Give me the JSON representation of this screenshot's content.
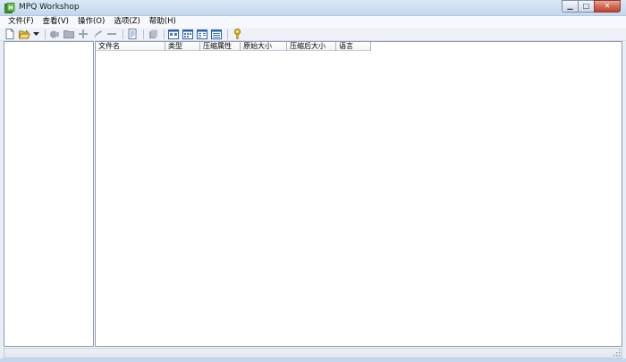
{
  "window": {
    "title": "MPQ Workshop",
    "minimize_symbol": "▁",
    "maximize_symbol": "□",
    "close_symbol": "✕"
  },
  "menu": [
    "文件(F)",
    "查看(V)",
    "操作(O)",
    "选项(Z)",
    "帮助(H)"
  ],
  "toolbar": {
    "groups": [
      [
        "new-file-icon",
        "open-folder-icon",
        "dropdown-arrow-icon"
      ],
      [
        "extract-icon",
        "folder-icon",
        "add-icon",
        "rename-icon",
        "remove-icon"
      ],
      [
        "properties-icon"
      ],
      [
        "compact-icon"
      ],
      [
        "large-icons-view-icon",
        "small-icons-view-icon",
        "list-view-icon",
        "details-view-icon"
      ],
      [
        "help-key-icon"
      ]
    ]
  },
  "file_list": {
    "columns": [
      "文件名",
      "类型",
      "压缩属性",
      "原始大小",
      "压缩后大小",
      "语言"
    ],
    "rows": []
  },
  "colors": {
    "titlebar": "#cddff2",
    "close_button": "#c0412c",
    "pane_border": "#8e9aad"
  }
}
